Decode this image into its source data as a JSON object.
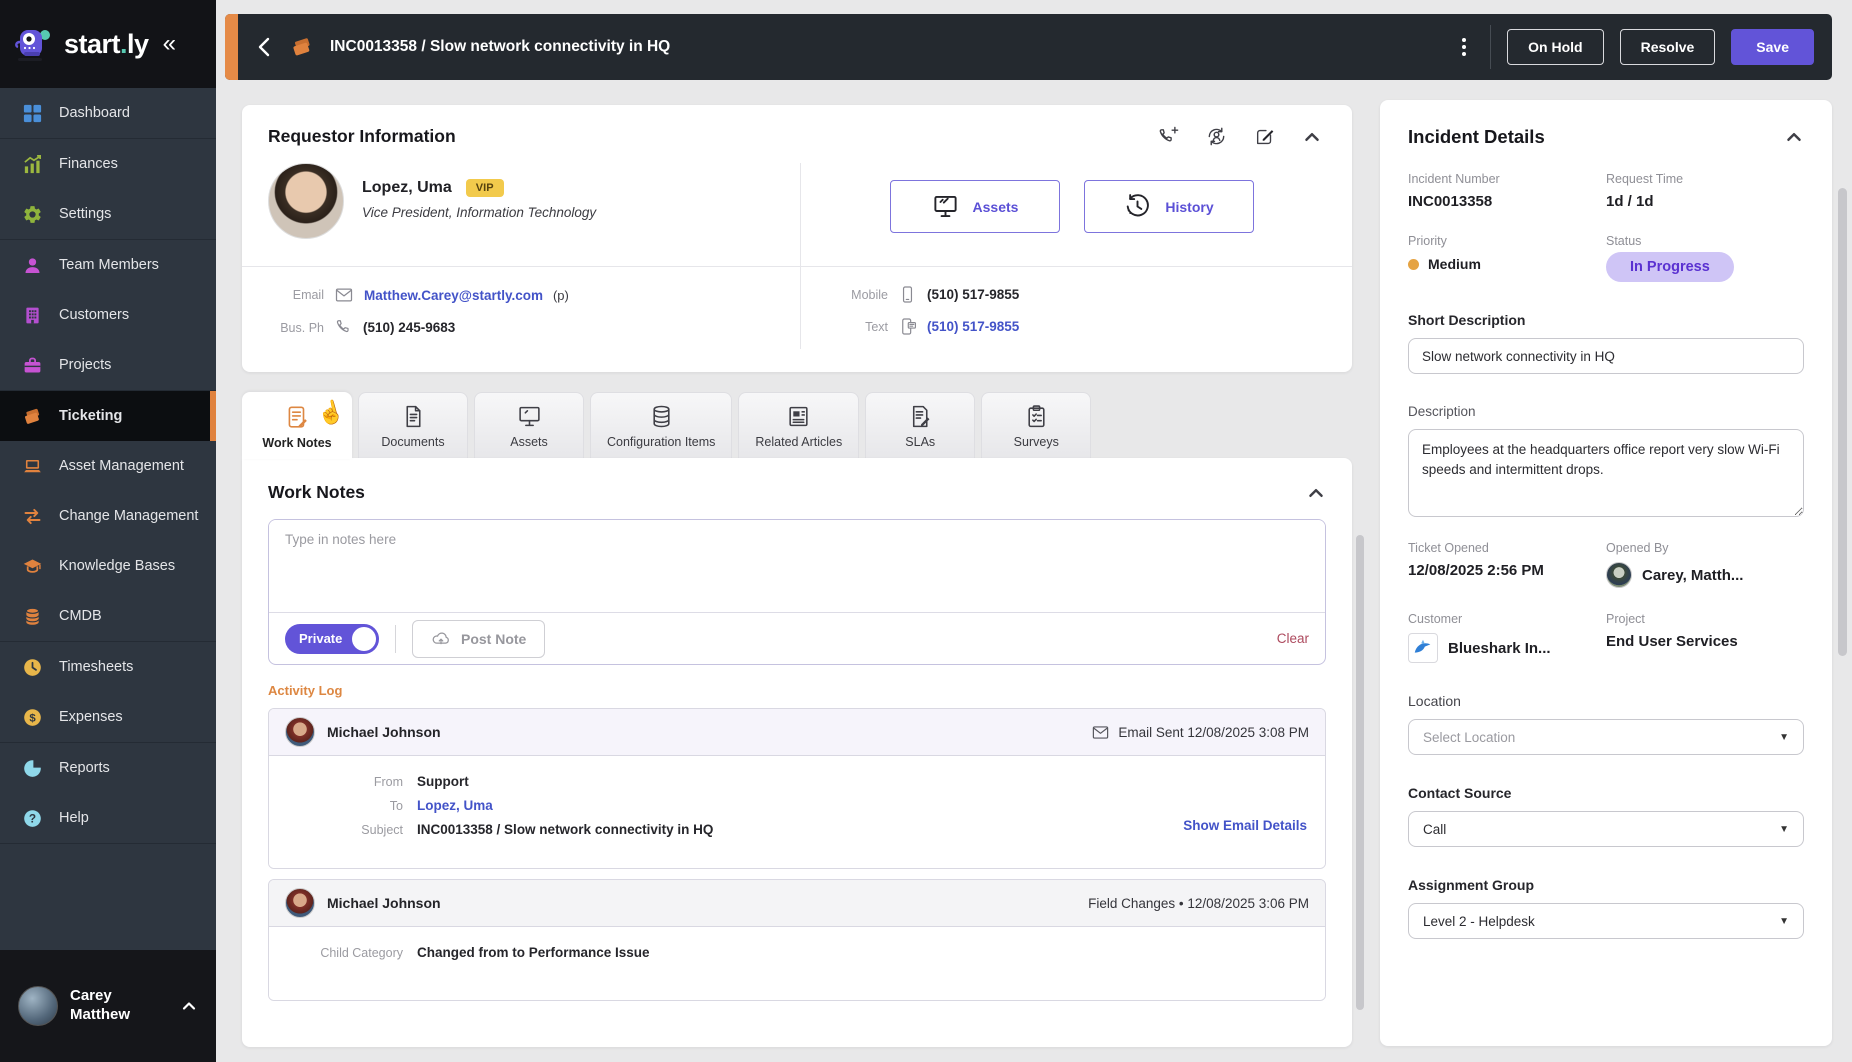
{
  "colors": {
    "accent_purple": "#6254d8",
    "accent_orange": "#e0823e",
    "link_blue": "#4353c8",
    "status_badge_bg": "#cfc5f6",
    "status_badge_text": "#5a31d1",
    "priority_medium_dot": "#e5a343",
    "vip_badge_bg": "#f2ca4c",
    "clear_link_red": "#ad4a5e"
  },
  "sidebar": {
    "logo_text_main": "start",
    "logo_text_dot": ".",
    "logo_text_suffix": "ly",
    "collapse_icon": "«",
    "items": [
      {
        "label": "Dashboard",
        "icon": "dashboard-grid-icon"
      },
      {
        "label": "Finances",
        "icon": "finances-chart-icon"
      },
      {
        "label": "Settings",
        "icon": "settings-gear-icon"
      },
      {
        "label": "Team Members",
        "icon": "person-icon"
      },
      {
        "label": "Customers",
        "icon": "building-icon"
      },
      {
        "label": "Projects",
        "icon": "briefcase-icon"
      },
      {
        "label": "Ticketing",
        "icon": "ticket-icon",
        "active": true
      },
      {
        "label": "Asset Management",
        "icon": "laptop-icon"
      },
      {
        "label": "Change Management",
        "icon": "swap-arrows-icon"
      },
      {
        "label": "Knowledge Bases",
        "icon": "graduation-cap-icon"
      },
      {
        "label": "CMDB",
        "icon": "database-icon"
      },
      {
        "label": "Timesheets",
        "icon": "clock-icon"
      },
      {
        "label": "Expenses",
        "icon": "dollar-icon"
      },
      {
        "label": "Reports",
        "icon": "pie-chart-icon"
      },
      {
        "label": "Help",
        "icon": "question-icon"
      }
    ],
    "user": {
      "name_line1": "Carey",
      "name_line2": "Matthew"
    }
  },
  "header": {
    "title": "INC0013358 / Slow network connectivity in HQ",
    "on_hold_label": "On Hold",
    "resolve_label": "Resolve",
    "save_label": "Save"
  },
  "requestor": {
    "title": "Requestor Information",
    "name": "Lopez, Uma",
    "vip_badge": "VIP",
    "job_title": "Vice President, Information Technology",
    "assets_button": "Assets",
    "history_button": "History",
    "email_label": "Email",
    "email": "Matthew.Carey@startly.com",
    "email_suffix": "(p)",
    "bus_ph_label": "Bus. Ph",
    "bus_ph": "(510) 245-9683",
    "mobile_label": "Mobile",
    "mobile": "(510) 517-9855",
    "text_label": "Text",
    "text": "(510) 517-9855"
  },
  "tabs": [
    {
      "label": "Work Notes",
      "active": true
    },
    {
      "label": "Documents"
    },
    {
      "label": "Assets"
    },
    {
      "label": "Configuration Items"
    },
    {
      "label": "Related Articles"
    },
    {
      "label": "SLAs"
    },
    {
      "label": "Surveys"
    }
  ],
  "work_notes": {
    "section_title": "Work Notes",
    "placeholder": "Type in notes here",
    "private_label": "Private",
    "post_note_label": "Post Note",
    "clear_label": "Clear",
    "activity_log_label": "Activity Log"
  },
  "activity": {
    "entries": [
      {
        "author": "Michael Johnson",
        "meta": "Email Sent 12/08/2025 3:08 PM",
        "from_label": "From",
        "from": "Support",
        "to_label": "To",
        "to": "Lopez, Uma",
        "subject_label": "Subject",
        "subject": "INC0013358 / Slow network connectivity in HQ",
        "details_link": "Show Email Details"
      },
      {
        "author": "Michael Johnson",
        "meta": "Field Changes • 12/08/2025 3:06 PM",
        "field_label": "Child Category",
        "field_value": "Changed from to Performance Issue"
      }
    ]
  },
  "incident": {
    "title": "Incident Details",
    "incident_number_label": "Incident Number",
    "incident_number": "INC0013358",
    "request_time_label": "Request Time",
    "request_time": "1d / 1d",
    "priority_label": "Priority",
    "priority": "Medium",
    "status_label": "Status",
    "status": "In Progress",
    "short_description_label": "Short Description",
    "short_description": "Slow network connectivity in HQ",
    "description_label": "Description",
    "description": "Employees at the headquarters office report very slow Wi-Fi speeds and intermittent drops.",
    "ticket_opened_label": "Ticket Opened",
    "ticket_opened": "12/08/2025 2:56 PM",
    "opened_by_label": "Opened By",
    "opened_by": "Carey, Matth...",
    "customer_label": "Customer",
    "customer": "Blueshark In...",
    "project_label": "Project",
    "project": "End User Services",
    "location_label": "Location",
    "location_placeholder": "Select Location",
    "contact_source_label": "Contact Source",
    "contact_source": "Call",
    "assignment_group_label": "Assignment Group",
    "assignment_group": "Level 2 - Helpdesk"
  }
}
